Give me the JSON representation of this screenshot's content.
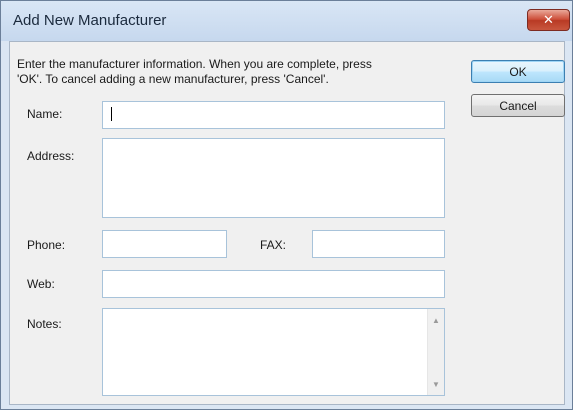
{
  "window": {
    "title": "Add New Manufacturer",
    "close_glyph": "✕"
  },
  "instructions": "Enter the manufacturer information. When you are complete, press\n'OK'. To cancel adding a new manufacturer, press 'Cancel'.",
  "buttons": {
    "ok_label": "OK",
    "cancel_label": "Cancel"
  },
  "form": {
    "name_label": "Name:",
    "name_value": "",
    "address_label": "Address:",
    "address_value": "",
    "phone_label": "Phone:",
    "phone_value": "",
    "fax_label": "FAX:",
    "fax_value": "",
    "web_label": "Web:",
    "web_value": "",
    "notes_label": "Notes:",
    "notes_value": ""
  },
  "scrollbar": {
    "up_glyph": "▲",
    "down_glyph": "▼"
  }
}
